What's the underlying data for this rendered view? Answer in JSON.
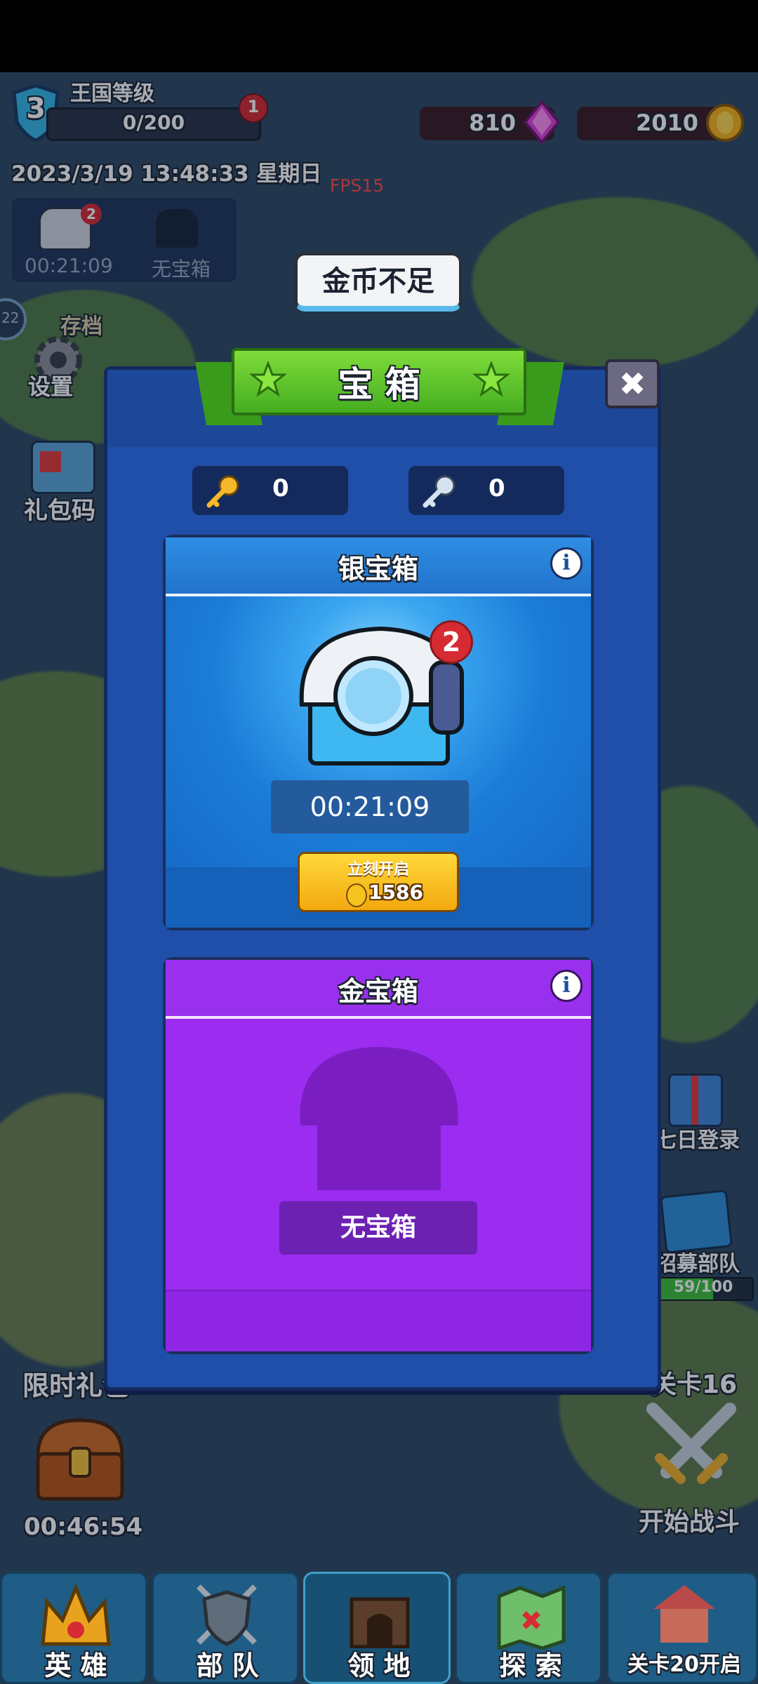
{
  "hud": {
    "level": "3",
    "kingdom_label": "王国等级",
    "progress": "0/200",
    "progress_fraction": 0,
    "notif_count": "1",
    "gems": "810",
    "coins": "2010",
    "datetime": "2023/3/19 13:48:33 星期日",
    "fps": "FPS15"
  },
  "mini_chests": {
    "badge": "2",
    "timer": "00:21:09",
    "empty_label": "无宝箱"
  },
  "left_side": {
    "save_label": "存档",
    "settings_label": "设置",
    "gift_code_label": "礼包码",
    "limited_gift_label": "限时礼包",
    "limited_timer": "00:46:54",
    "edge_number": "22"
  },
  "right_side": {
    "seven_day_label": "七日登录",
    "recruit_label": "招募部队",
    "recruit_progress": "59/100",
    "recruit_fraction": 0.59,
    "stage_label": "关卡16",
    "start_battle_label": "开始战斗"
  },
  "toast": "金币不足",
  "dialog": {
    "title": "宝 箱",
    "gold_key_count": "0",
    "silver_key_count": "0",
    "silver_chest": {
      "title": "银宝箱",
      "badge": "2",
      "timer": "00:21:09",
      "open_now_label": "立刻开启",
      "open_cost": "1586"
    },
    "gold_chest": {
      "title": "金宝箱",
      "empty_label": "无宝箱"
    }
  },
  "nav": {
    "heroes": "英 雄",
    "troops": "部 队",
    "territory": "领 地",
    "explore": "探 索",
    "stage20": "关卡20开启"
  },
  "colors": {
    "silver_card": "#1f84e0",
    "gold_card": "#9b2cf0",
    "title_green": "#5fc92a",
    "coin": "#f6b41a",
    "gem": "#e040d8"
  }
}
